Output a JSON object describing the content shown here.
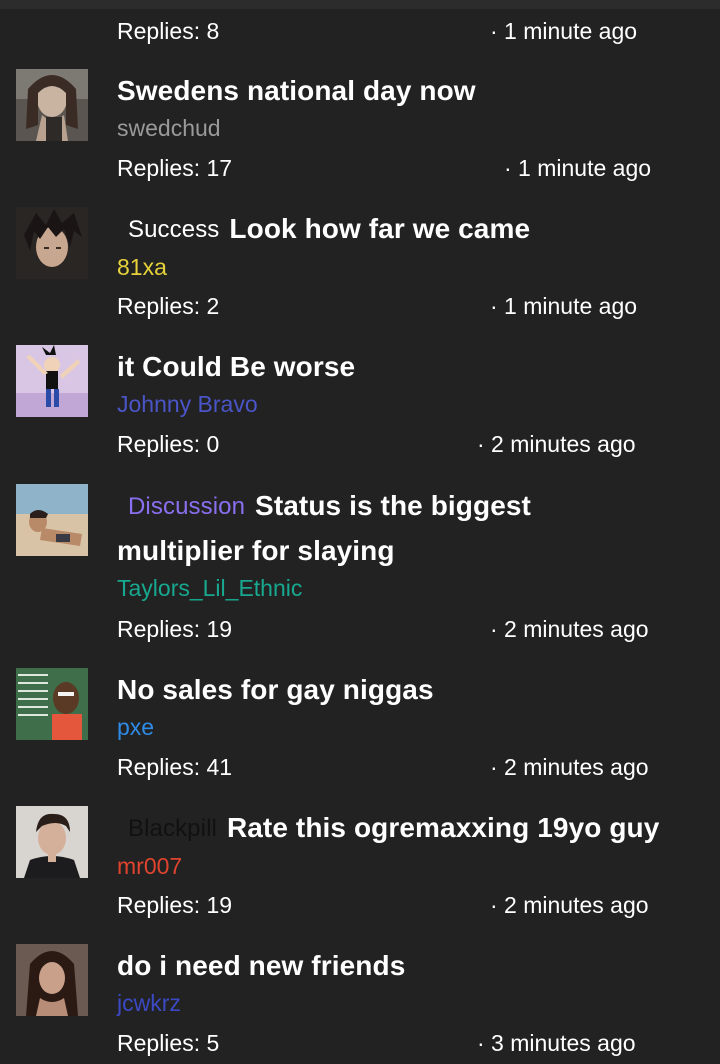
{
  "partial_top": {
    "replies": "Replies: 8",
    "time": "· 1 minute ago"
  },
  "threads": [
    {
      "tag": "",
      "title": "Swedens national day now",
      "author": "swedchud",
      "author_color": "#9a9a9a",
      "replies": "Replies: 17",
      "time": "· 1 minute ago",
      "avatar": "woman-portrait-avatar"
    },
    {
      "tag": "Success",
      "tag_color": "#ffffff",
      "title": "Look how far we came",
      "author": "81xa",
      "author_color": "#e6d23a",
      "replies": "Replies: 2",
      "time": "· 1 minute ago",
      "avatar": "anime-character-avatar"
    },
    {
      "tag": "",
      "title": "it Could Be worse",
      "author": "Johnny Bravo",
      "author_color": "#4a55c8",
      "replies": "Replies: 0",
      "time": "· 2 minutes ago",
      "avatar": "cartoon-avatar"
    },
    {
      "tag": "Discussion",
      "tag_color": "#8a6ff0",
      "title": "Status is the biggest",
      "title_line2": "multiplier for slaying",
      "author": "Taylors_Lil_Ethnic",
      "author_color": "#17a88f",
      "replies": "Replies: 19",
      "time": "· 2 minutes ago",
      "avatar": "beach-avatar"
    },
    {
      "tag": "",
      "title": "No sales for gay niggas",
      "author": "pxe",
      "author_color": "#2e8be6",
      "replies": "Replies: 41",
      "time": "· 2 minutes ago",
      "avatar": "chalkboard-cartoon-avatar"
    },
    {
      "tag": "Blackpill",
      "tag_color": "#111111",
      "title": "Rate this ogremaxxing 19yo guy",
      "author": "mr007",
      "author_color": "#e0442e",
      "replies": "Replies: 19",
      "time": "· 2 minutes ago",
      "avatar": "man-portrait-avatar"
    },
    {
      "tag": "",
      "title": "do i need new friends",
      "author": "jcwkrz",
      "author_color": "#3c49c4",
      "replies": "Replies: 5",
      "time": "· 3 minutes ago",
      "avatar": "girl-portrait-avatar"
    }
  ]
}
